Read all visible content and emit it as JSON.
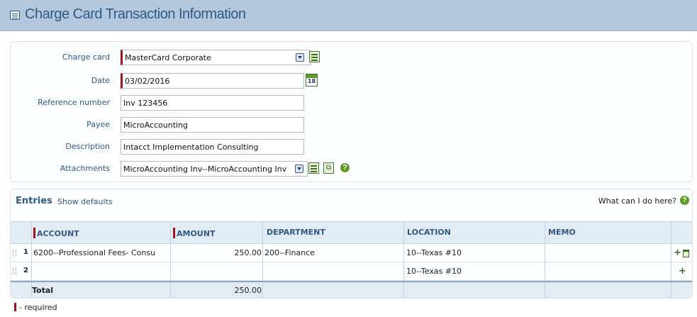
{
  "header": {
    "title": "Charge Card Transaction Information"
  },
  "form": {
    "charge_card": {
      "label": "Charge card",
      "value": "MasterCard Corporate"
    },
    "date": {
      "label": "Date",
      "value": "03/02/2016",
      "calendar_day": "18"
    },
    "reference_number": {
      "label": "Reference number",
      "value": "Inv 123456"
    },
    "payee": {
      "label": "Payee",
      "value": "MicroAccounting"
    },
    "description": {
      "label": "Description",
      "value": "Intacct Implementation Consulting"
    },
    "attachments": {
      "label": "Attachments",
      "value": "MicroAccounting Inv--MicroAccounting Inv",
      "help": "?"
    }
  },
  "entries": {
    "title": "Entries",
    "show_defaults": "Show defaults",
    "what_can_i_do": "What can I do here?",
    "help": "?",
    "columns": {
      "account": "ACCOUNT",
      "amount": "AMOUNT",
      "department": "DEPARTMENT",
      "location": "LOCATION",
      "memo": "MEMO"
    },
    "rows": [
      {
        "num": "1",
        "account": "6200--Professional Fees- Consu",
        "amount": "250.00",
        "department": "200--Finance",
        "location": "10--Texas #10",
        "memo": ""
      },
      {
        "num": "2",
        "account": "",
        "amount": "",
        "department": "",
        "location": "10--Texas #10",
        "memo": ""
      }
    ],
    "total_label": "Total",
    "total_amount": "250.00"
  },
  "footer": {
    "required_text": "- required"
  },
  "colors": {
    "header_bg": "#b4c8dd",
    "title": "#2f5a84",
    "required": "#a0141e",
    "icon_green": "#5f9b2b"
  }
}
